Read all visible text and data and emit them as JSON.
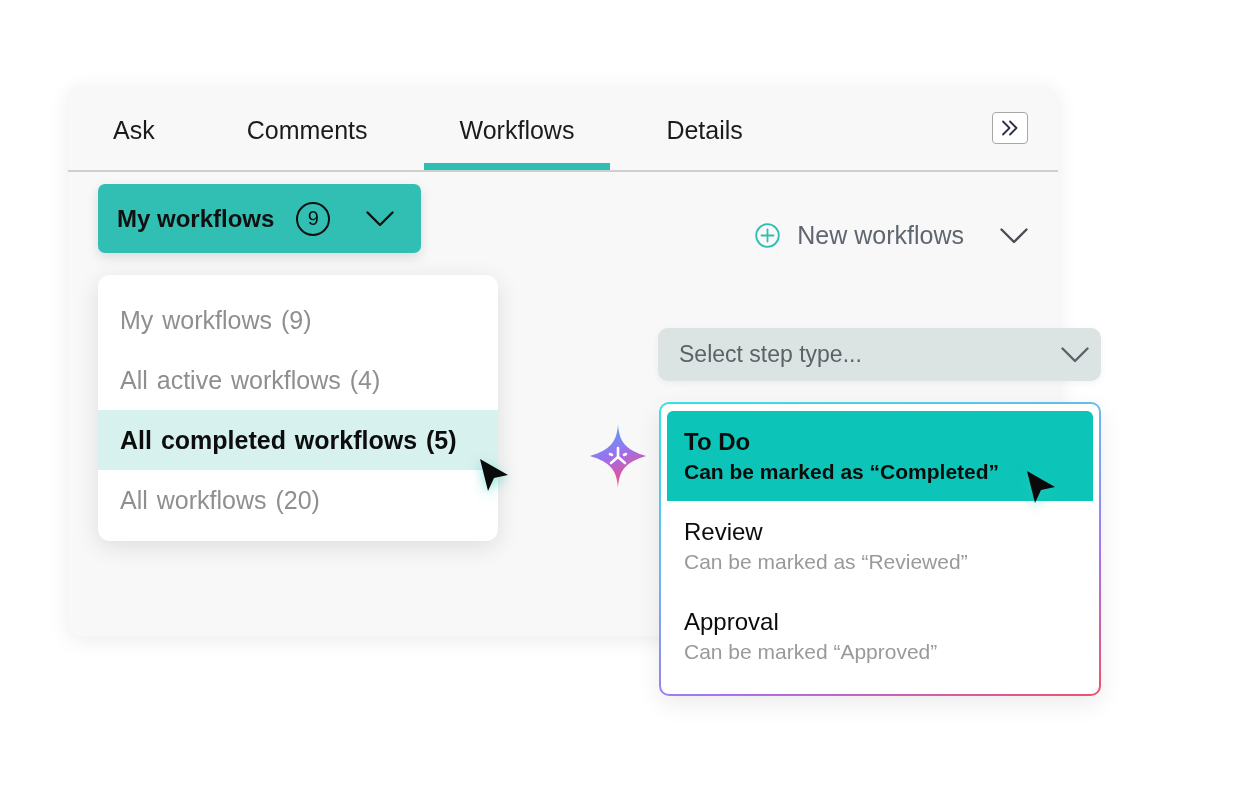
{
  "tabs": [
    {
      "label": "Ask",
      "selected": false
    },
    {
      "label": "Comments",
      "selected": false
    },
    {
      "label": "Workflows",
      "selected": true
    },
    {
      "label": "Details",
      "selected": false
    }
  ],
  "workflow_filter": {
    "label": "My workflows",
    "count": "9"
  },
  "new_workflow_button": {
    "label": "New workflows"
  },
  "filter_menu": {
    "items": [
      {
        "label": "My workflows (9)",
        "selected": false
      },
      {
        "label": "All active workflows (4)",
        "selected": false
      },
      {
        "label": "All completed workflows (5)",
        "selected": true
      },
      {
        "label": "All workflows (20)",
        "selected": false
      }
    ]
  },
  "step_type_select": {
    "placeholder": "Select step type..."
  },
  "step_type_menu": {
    "items": [
      {
        "title": "To Do",
        "description": "Can be marked as “Completed”",
        "selected": true
      },
      {
        "title": "Review",
        "description": "Can be marked as “Reviewed”",
        "selected": false
      },
      {
        "title": "Approval",
        "description": "Can be marked “Approved”",
        "selected": false
      }
    ]
  }
}
